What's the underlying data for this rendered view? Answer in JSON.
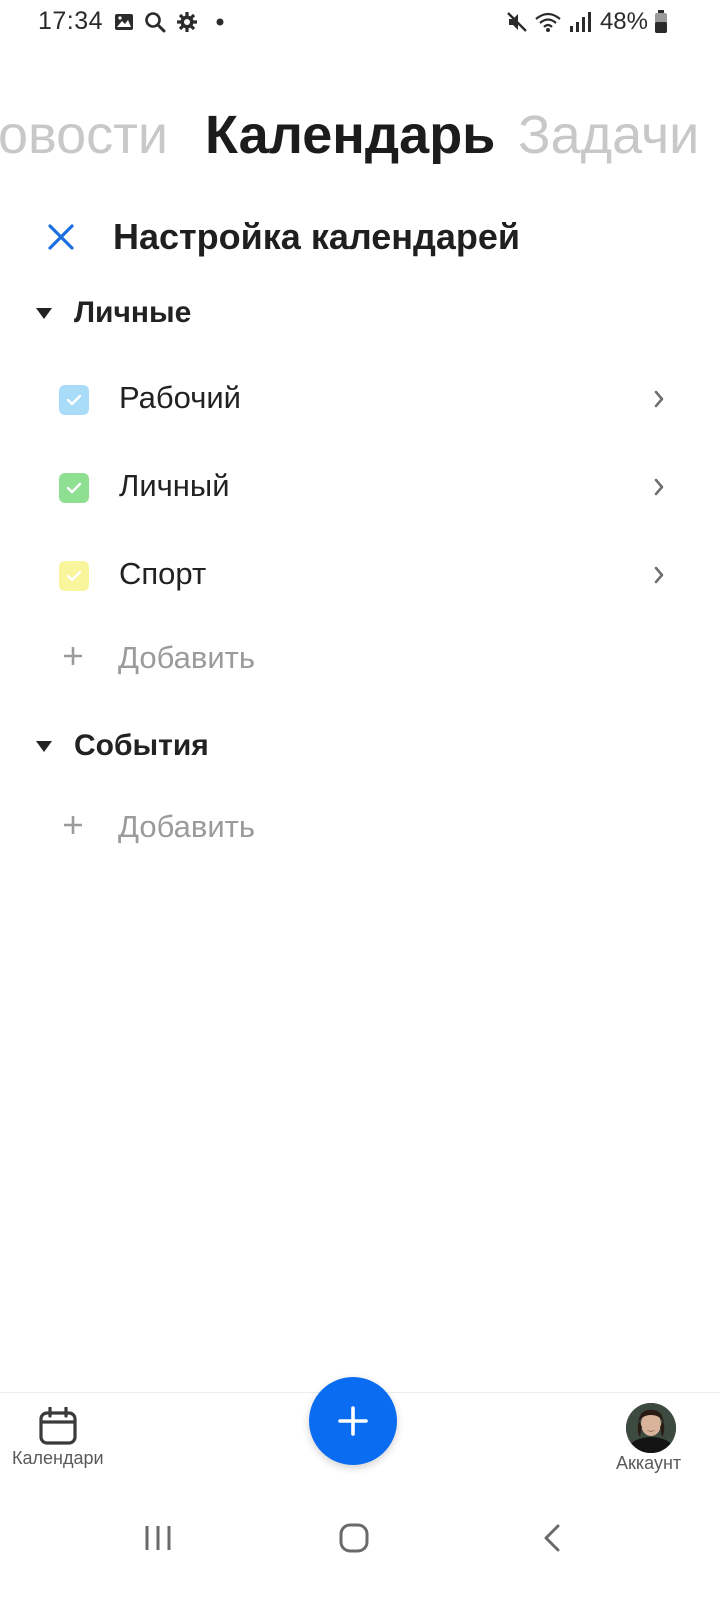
{
  "status_bar": {
    "time": "17:34",
    "battery": "48%",
    "left_icons": [
      "gallery-icon",
      "search-icon",
      "gear-icon",
      "dot-icon"
    ],
    "right_icons": [
      "mute-icon",
      "wifi-icon",
      "signal-icon",
      "battery-icon"
    ]
  },
  "carousel": {
    "left": "Новости",
    "center": "Календарь",
    "right": "Задачи"
  },
  "header": {
    "title": "Настройка календарей"
  },
  "sections": {
    "personal": {
      "label": "Личные",
      "calendars": [
        {
          "name": "Рабочий",
          "color": "#a9dcf8",
          "checked": true
        },
        {
          "name": "Личный",
          "color": "#8fdf92",
          "checked": true
        },
        {
          "name": "Спорт",
          "color": "#f8f59c",
          "checked": true
        }
      ],
      "add_label": "Добавить"
    },
    "events": {
      "label": "События",
      "add_label": "Добавить"
    }
  },
  "bottom_bar": {
    "calendars_label": "Календари",
    "account_label": "Аккаунт"
  },
  "colors": {
    "accent": "#0a6cf0",
    "close_icon": "#1c6fe0"
  }
}
